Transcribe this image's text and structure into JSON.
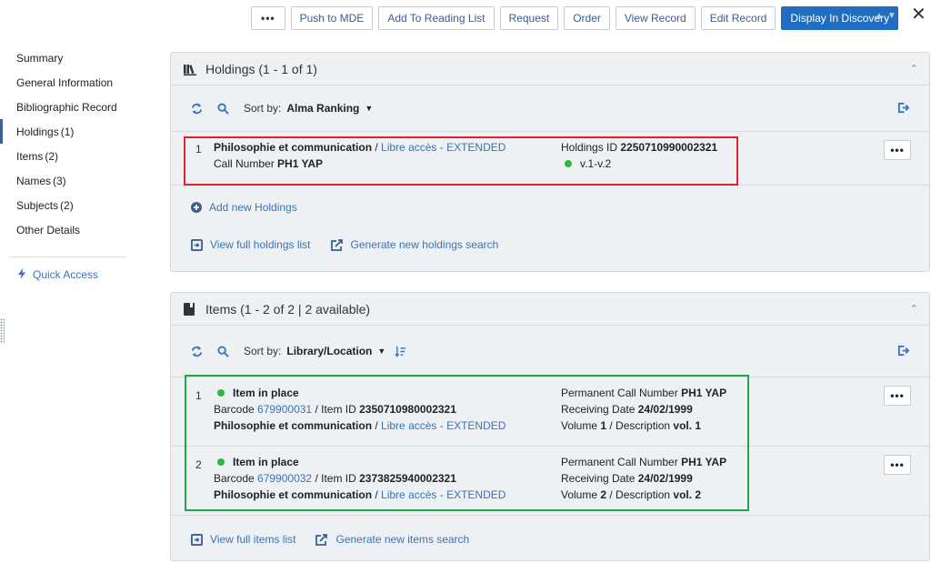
{
  "toolbar": {
    "more_label": "•••",
    "buttons": [
      "Push to MDE",
      "Add To Reading List",
      "Request",
      "Order",
      "View Record",
      "Edit Record"
    ],
    "primary_label": "Display In Discovery",
    "close_label": "✕"
  },
  "sidebar": {
    "items": [
      {
        "label": "Summary",
        "count": ""
      },
      {
        "label": "General Information",
        "count": ""
      },
      {
        "label": "Bibliographic Record",
        "count": ""
      },
      {
        "label": "Holdings",
        "count": "(1)"
      },
      {
        "label": "Items",
        "count": "(2)"
      },
      {
        "label": "Names",
        "count": "(3)"
      },
      {
        "label": "Subjects",
        "count": "(2)"
      },
      {
        "label": "Other Details",
        "count": ""
      }
    ],
    "quick_access": "Quick Access"
  },
  "holdings": {
    "title": "Holdings (1 - 1 of 1)",
    "sort_label": "Sort by:",
    "sort_value": "Alma Ranking",
    "row": {
      "num": "1",
      "library": "Philosophie et communication",
      "separator": " / ",
      "location": "Libre accès - EXTENDED",
      "call_label": "Call Number ",
      "call_value": "PH1 YAP",
      "id_label": "Holdings ID ",
      "id_value": "2250710990002321",
      "range": "v.1-v.2",
      "more": "•••"
    },
    "add_label": "Add new Holdings",
    "view_full": "View full holdings list",
    "generate": "Generate new holdings search"
  },
  "items": {
    "title": "Items (1 - 2 of 2  |  2 available)",
    "sort_label": "Sort by:",
    "sort_value": "Library/Location",
    "rows": [
      {
        "num": "1",
        "status": "Item in place",
        "barcode_label": "Barcode ",
        "barcode": "679900031",
        "itemid_label": " / Item ID  ",
        "itemid": "2350710980002321",
        "library": "Philosophie et communication",
        "separator": " / ",
        "location": "Libre accès - EXTENDED",
        "pcn_label": "Permanent Call Number ",
        "pcn": "PH1 YAP",
        "rd_label": "Receiving Date ",
        "rd": "24/02/1999",
        "vol_label": "Volume ",
        "vol": "1",
        "desc_label": " /  Description ",
        "desc": "vol. 1",
        "more": "•••"
      },
      {
        "num": "2",
        "status": "Item in place",
        "barcode_label": "Barcode ",
        "barcode": "679900032",
        "itemid_label": " / Item ID  ",
        "itemid": "2373825940002321",
        "library": "Philosophie et communication",
        "separator": " / ",
        "location": "Libre accès - EXTENDED",
        "pcn_label": "Permanent Call Number ",
        "pcn": "PH1 YAP",
        "rd_label": "Receiving Date ",
        "rd": "24/02/1999",
        "vol_label": "Volume ",
        "vol": "2",
        "desc_label": " /  Description ",
        "desc": "vol. 2",
        "more": "•••"
      }
    ],
    "view_full": "View full items list",
    "generate": "Generate new items search"
  },
  "colors": {
    "accent": "#1f6ec4",
    "link": "#3a73b8",
    "available_dot": "#2db843",
    "highlight_red": "#e0222c",
    "highlight_green": "#1fa84a"
  }
}
